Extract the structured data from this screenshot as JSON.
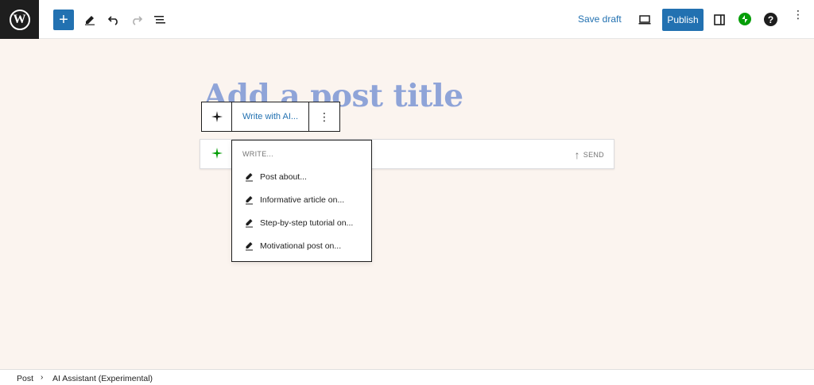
{
  "header": {
    "logo": "W",
    "add_label": "+",
    "save_draft": "Save draft",
    "publish": "Publish",
    "help": "?",
    "more": "⋮",
    "icons": [
      "wordpress-logo",
      "add-block",
      "edit-tools-pencil",
      "undo",
      "redo",
      "document-overview",
      "preview-desktop",
      "settings-sidebar",
      "jetpack",
      "help",
      "options"
    ]
  },
  "editor": {
    "title_placeholder": "Add a post title",
    "block_toolbar": {
      "write_with_ai": "Write with AI...",
      "more": "⋮"
    },
    "ai_input": {
      "send": "SEND"
    },
    "dropdown": {
      "header": "WRITE...",
      "items": [
        {
          "label": "Post about..."
        },
        {
          "label": "Informative article on..."
        },
        {
          "label": "Step-by-step tutorial on..."
        },
        {
          "label": "Motivational post on..."
        }
      ]
    }
  },
  "footer": {
    "breadcrumb": [
      "Post",
      "AI Assistant (Experimental)"
    ]
  },
  "colors": {
    "accent": "#2271b1",
    "canvas_bg": "#fbf4ef",
    "title_placeholder": "#8fa4d8",
    "jetpack_green": "#069e08",
    "ai_sparkle_green": "#069e08"
  }
}
